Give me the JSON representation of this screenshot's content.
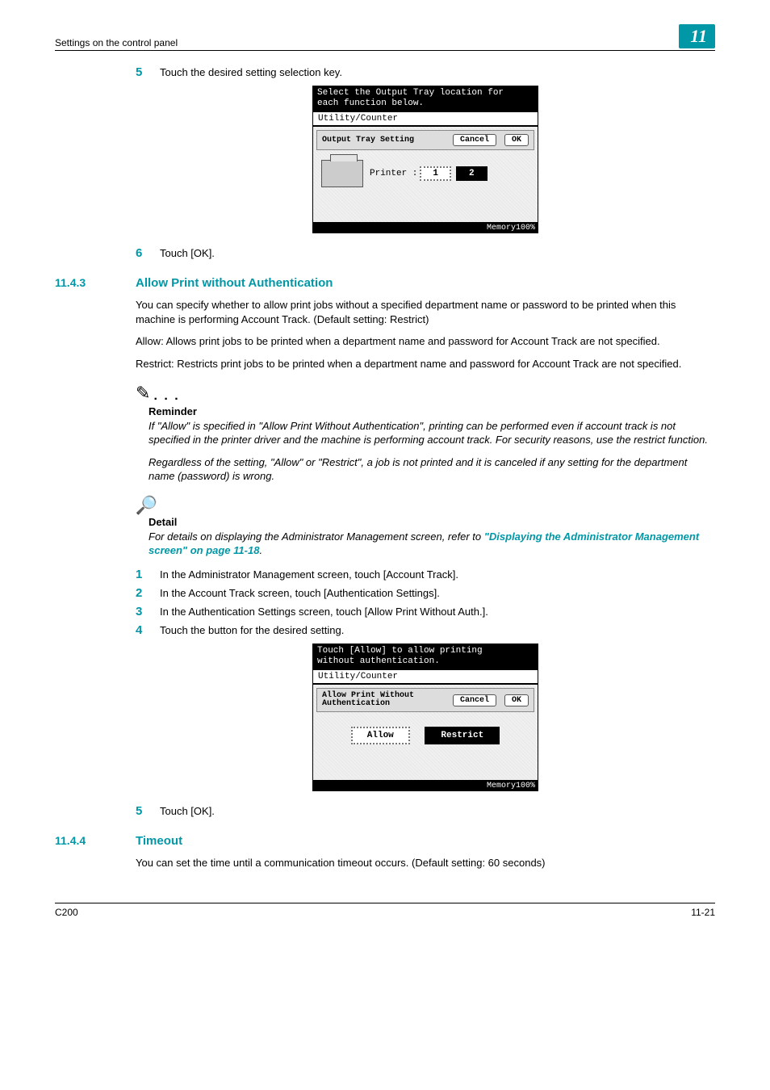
{
  "header": {
    "section": "Settings on the control panel",
    "chapter": "11"
  },
  "step5a": {
    "num": "5",
    "text": "Touch the desired setting selection key."
  },
  "screenshot1": {
    "top1": "Select the Output Tray location for",
    "top2": "each function below.",
    "util": "Utility/Counter",
    "title": "Output Tray Setting",
    "cancel": "Cancel",
    "ok": "OK",
    "printer_label": "Printer :",
    "tray1": "1",
    "tray2": "2",
    "memory": "Memory100%"
  },
  "step6": {
    "num": "6",
    "text": "Touch [OK]."
  },
  "sec1143": {
    "num": "11.4.3",
    "title": "Allow Print without Authentication",
    "p1": "You can specify whether to allow print jobs without a specified department name or password to be printed when this machine is performing Account Track. (Default setting: Restrict)",
    "p2": "Allow: Allows print jobs to be printed when a department name and password for Account Track are not specified.",
    "p3": "Restrict: Restricts print jobs to be printed when a department name and password for Account Track are not specified."
  },
  "reminder": {
    "label": "Reminder",
    "p1": "If \"Allow\" is specified in \"Allow Print Without Authentication\", printing can be performed even if account track is not specified in the printer driver and the machine is performing account track. For security reasons, use the restrict function.",
    "p2": "Regardless of the setting, \"Allow\" or \"Restrict\", a job is not printed and it is canceled if any setting for the department name (password) is wrong."
  },
  "detail": {
    "label": "Detail",
    "prefix": "For details on displaying the Administrator Management screen, refer to ",
    "link": "\"Displaying the Administrator Management screen\" on page 11-18",
    "suffix": "."
  },
  "steps_b": {
    "s1": {
      "num": "1",
      "text": "In the Administrator Management screen, touch [Account Track]."
    },
    "s2": {
      "num": "2",
      "text": "In the Account Track screen, touch [Authentication Settings]."
    },
    "s3": {
      "num": "3",
      "text": "In the Authentication Settings screen, touch [Allow Print Without Auth.]."
    },
    "s4": {
      "num": "4",
      "text": "Touch the button for the desired setting."
    }
  },
  "screenshot2": {
    "top1": "Touch [Allow] to allow printing",
    "top2": "without authentication.",
    "util": "Utility/Counter",
    "title_l1": "Allow Print Without",
    "title_l2": "Authentication",
    "cancel": "Cancel",
    "ok": "OK",
    "allow": "Allow",
    "restrict": "Restrict",
    "memory": "Memory100%"
  },
  "step5b": {
    "num": "5",
    "text": "Touch [OK]."
  },
  "sec1144": {
    "num": "11.4.4",
    "title": "Timeout",
    "p1": "You can set the time until a communication timeout occurs. (Default setting: 60 seconds)"
  },
  "footer": {
    "left": "C200",
    "right": "11-21"
  }
}
